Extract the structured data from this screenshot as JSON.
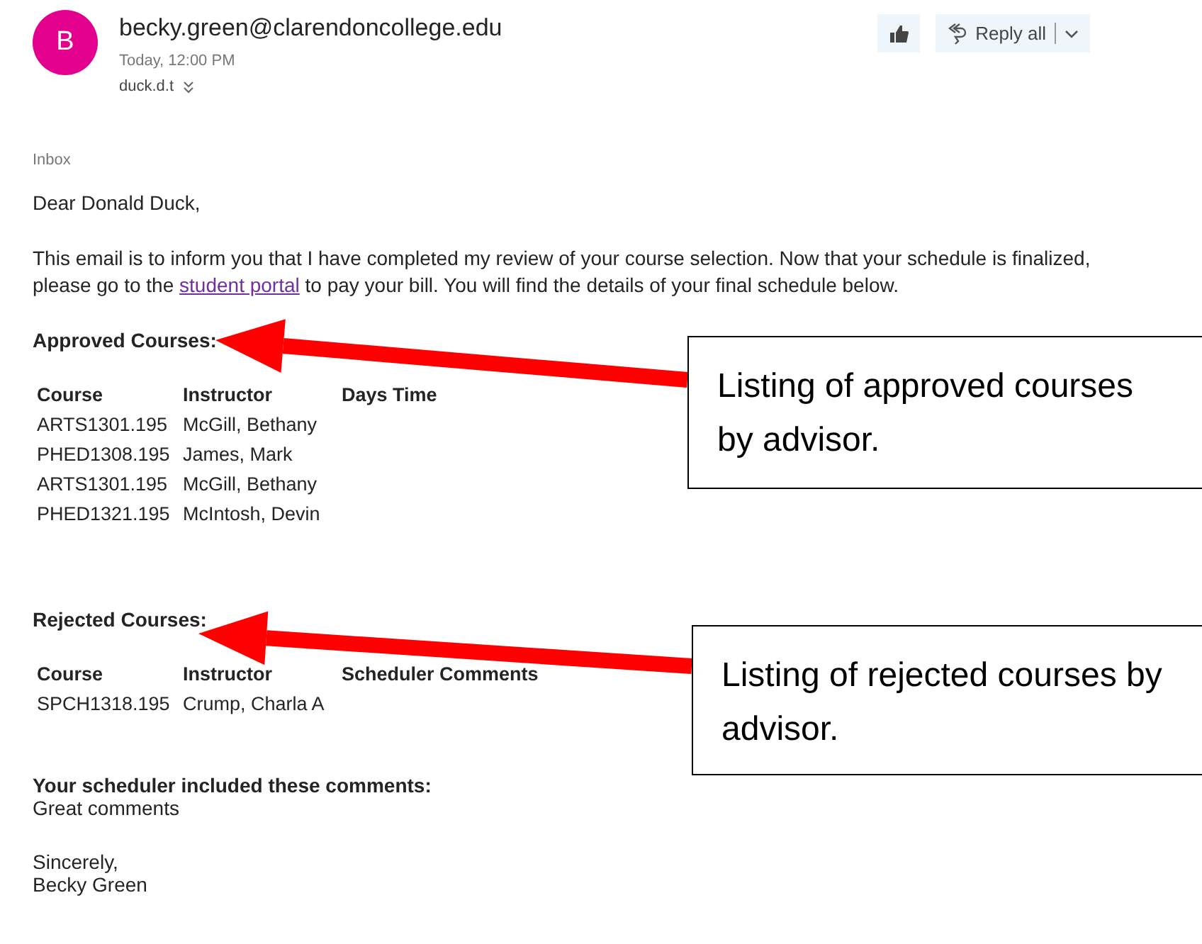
{
  "message": {
    "avatar_initial": "B",
    "sender": "becky.green@clarendoncollege.edu",
    "time": "Today, 12:00 PM",
    "recipient": "duck.d.t",
    "folder": "Inbox"
  },
  "actions": {
    "reply_all": "Reply all"
  },
  "body": {
    "greeting": "Dear Donald Duck,",
    "intro": "This email is to inform you that I have completed my review of your course selection. Now that your schedule is finalized, please go to the ",
    "link": "student portal",
    "intro_end": " to pay your bill. You will find the details of your final schedule below.",
    "sections": [
      {
        "heading": "Approved Courses:",
        "columns": [
          "Course",
          "Instructor",
          "Days Time"
        ],
        "rows": [
          [
            "ARTS1301.195",
            "McGill, Bethany"
          ],
          [
            "PHED1308.195",
            "James, Mark"
          ],
          [
            "ARTS1301.195",
            "McGill, Bethany"
          ],
          [
            "PHED1321.195",
            "McIntosh, Devin"
          ]
        ]
      },
      {
        "heading": "Rejected Courses:",
        "columns": [
          "Course",
          "Instructor",
          "Scheduler Comments"
        ],
        "rows": [
          [
            "SPCH1318.195",
            "Crump, Charla A"
          ]
        ]
      }
    ],
    "comments_heading": "Your scheduler included these comments:",
    "comments": "Great comments",
    "closing": "Sincerely,",
    "signature": "Becky Green"
  },
  "callouts": [
    {
      "text": "Listing of approved courses by advisor."
    },
    {
      "text": "Listing of rejected courses by advisor."
    }
  ]
}
